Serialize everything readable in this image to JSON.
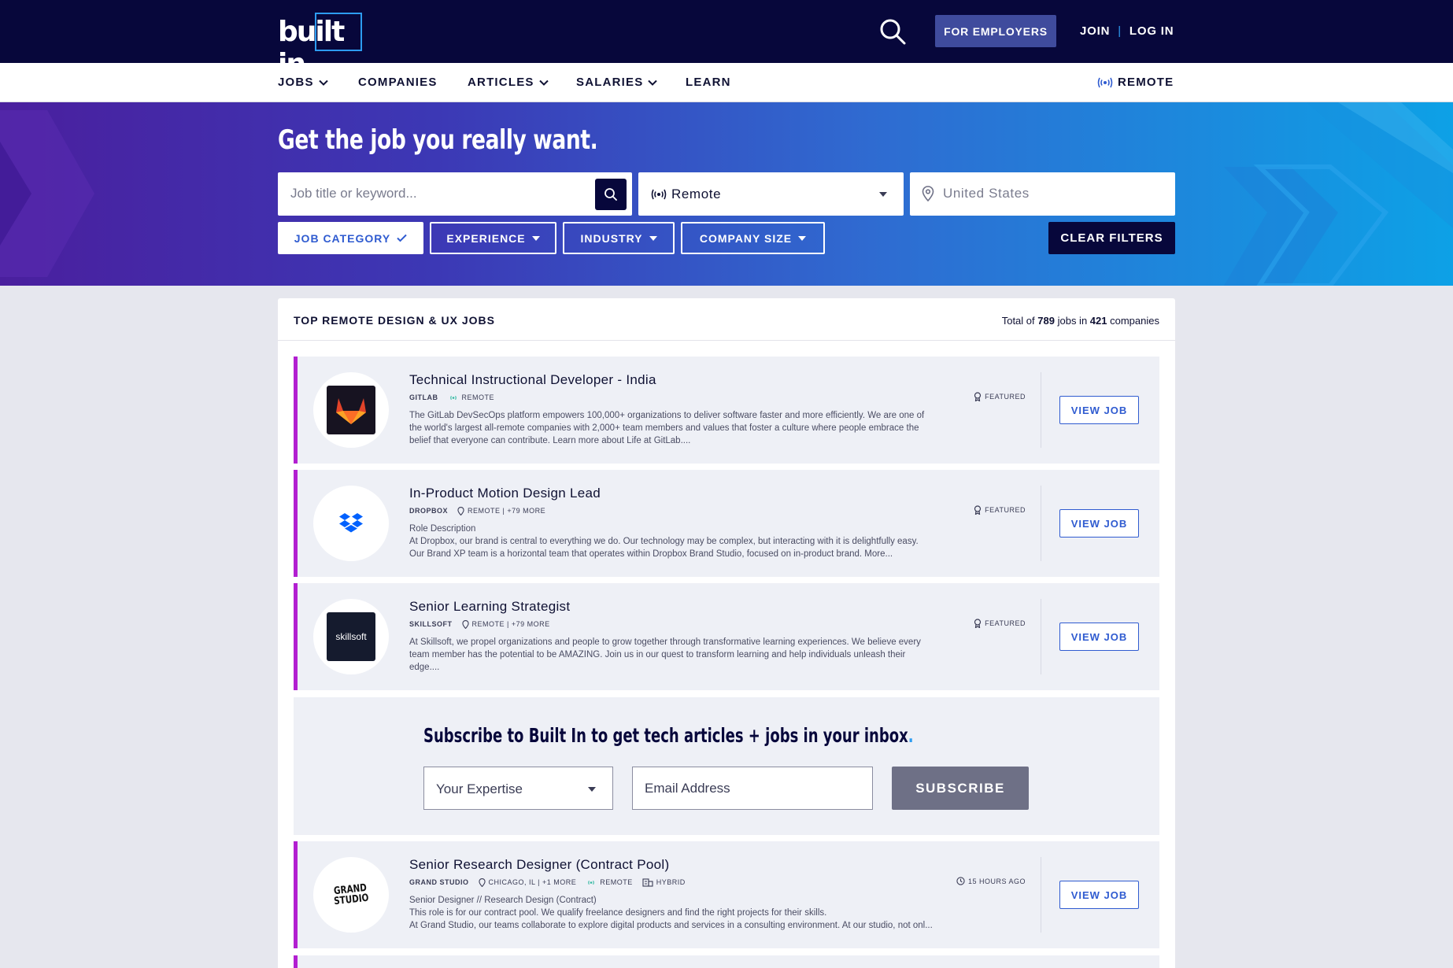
{
  "brand": {
    "logo_text": "built in",
    "accent": "#2d9cf0",
    "navy": "#07073b",
    "card_accent": "#b21fd1"
  },
  "header": {
    "employers_label": "FOR EMPLOYERS",
    "join_label": "JOIN",
    "separator": "|",
    "login_label": "LOG IN"
  },
  "nav": {
    "jobs": "JOBS",
    "companies": "COMPANIES",
    "articles": "ARTICLES",
    "salaries": "SALARIES",
    "learn": "LEARN",
    "remote": "REMOTE"
  },
  "hero": {
    "title": "Get the job you really want.",
    "keyword_placeholder": "Job title or keyword...",
    "remote_value": "Remote",
    "location_placeholder": "United States",
    "filters": {
      "job_category": "JOB CATEGORY",
      "experience": "EXPERIENCE",
      "industry": "INDUSTRY",
      "company_size": "COMPANY SIZE"
    },
    "clear_filters": "CLEAR FILTERS"
  },
  "results": {
    "heading": "TOP REMOTE DESIGN & UX JOBS",
    "total_prefix": "Total of",
    "total_jobs": "789",
    "total_mid": "jobs in",
    "total_companies": "421",
    "total_suffix": "companies"
  },
  "jobs": [
    {
      "title": "Technical Instructional Developer - India",
      "company": "GITLAB",
      "meta1": "REMOTE",
      "badge": "FEATURED",
      "desc": [
        "The GitLab DevSecOps platform empowers 100,000+ organizations to deliver software faster and more efficiently. We are one of",
        "the world's largest all-remote companies with 2,000+ team members and values that foster a culture where people embrace the",
        "belief that everyone can contribute. Learn more about Life at GitLab...."
      ],
      "view_label": "VIEW JOB"
    },
    {
      "title": "In-Product Motion Design Lead",
      "company": "DROPBOX",
      "meta1": "REMOTE | +79 MORE",
      "badge": "FEATURED",
      "desc": [
        "Role Description",
        "At Dropbox, our brand is central to everything we do. Our technology may be complex, but interacting with it is delightfully easy.",
        "Our Brand XP team is a horizontal team that operates within Dropbox Brand Studio, focused on in-product brand. More..."
      ],
      "view_label": "VIEW JOB"
    },
    {
      "title": "Senior Learning Strategist",
      "company": "SKILLSOFT",
      "meta1": "REMOTE | +79 MORE",
      "logo_text": "skillsoft",
      "badge": "FEATURED",
      "desc": [
        "At Skillsoft, we propel organizations and people to grow together through transformative learning experiences. We believe every",
        "team member has the potential to be AMAZING. Join us in our quest to transform learning and help individuals unleash their",
        "edge...."
      ],
      "view_label": "VIEW JOB"
    },
    {
      "title": "Senior Research Designer (Contract Pool)",
      "company": "GRAND STUDIO",
      "meta1": "CHICAGO, IL | +1 MORE",
      "meta2": "REMOTE",
      "meta3": "HYBRID",
      "logo_text_1": "GRAND",
      "logo_text_2": "STUDIO",
      "badge": "15 HOURS AGO",
      "desc": [
        "Senior Designer // Research Design (Contract)",
        "This role is for our contract pool. We qualify freelance designers and find the right projects for their skills.",
        "At Grand Studio, our teams collaborate to explore digital products and services in a consulting environment. At our studio, not onl..."
      ],
      "view_label": "VIEW JOB"
    }
  ],
  "subscribe": {
    "title": "Subscribe to Built In to get tech articles + jobs in your inbox",
    "dot": ".",
    "expertise_value": "Your Expertise",
    "email_placeholder": "Email Address",
    "button": "SUBSCRIBE"
  }
}
